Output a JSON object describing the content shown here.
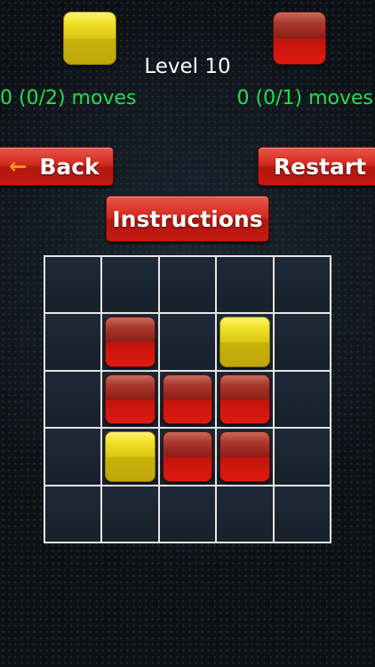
{
  "header": {
    "player1_color": "yellow",
    "player2_color": "red",
    "level_label": "Level 10",
    "player1_moves": "0 (0/2) moves",
    "player2_moves": "0 (0/1) moves"
  },
  "buttons": {
    "back_label": "Back",
    "restart_label": "Restart",
    "instructions_label": "Instructions"
  },
  "colors": {
    "yellow": "#e0cd14",
    "red": "#c2140c",
    "moves_text": "#22e04a",
    "button_red": "#d4291f"
  },
  "board": {
    "rows": 5,
    "cols": 5,
    "cells": [
      [
        "",
        "",
        "",
        "",
        ""
      ],
      [
        "",
        "red",
        "",
        "yellow",
        ""
      ],
      [
        "",
        "red",
        "red",
        "red",
        ""
      ],
      [
        "",
        "yellow",
        "red",
        "red",
        ""
      ],
      [
        "",
        "",
        "",
        "",
        ""
      ]
    ]
  }
}
